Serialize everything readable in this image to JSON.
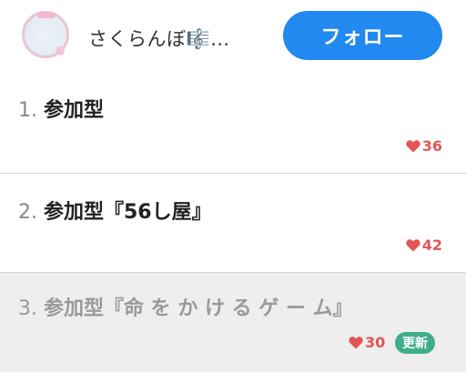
{
  "header": {
    "username": "さくらんぼ🎼…",
    "follow_label": "フォロー"
  },
  "items": [
    {
      "number": "1.",
      "title": "参加型",
      "likes": "36"
    },
    {
      "number": "2.",
      "title": "参加型『56し屋』",
      "likes": "42"
    },
    {
      "number": "3.",
      "title": "参加型『命 を か け る ゲ ー ム』",
      "likes": "30",
      "badge": "更新"
    }
  ],
  "colors": {
    "follow_button": "#2189f0",
    "like": "#e35454",
    "badge": "#3fae8b",
    "read_background": "#eeeeee"
  }
}
